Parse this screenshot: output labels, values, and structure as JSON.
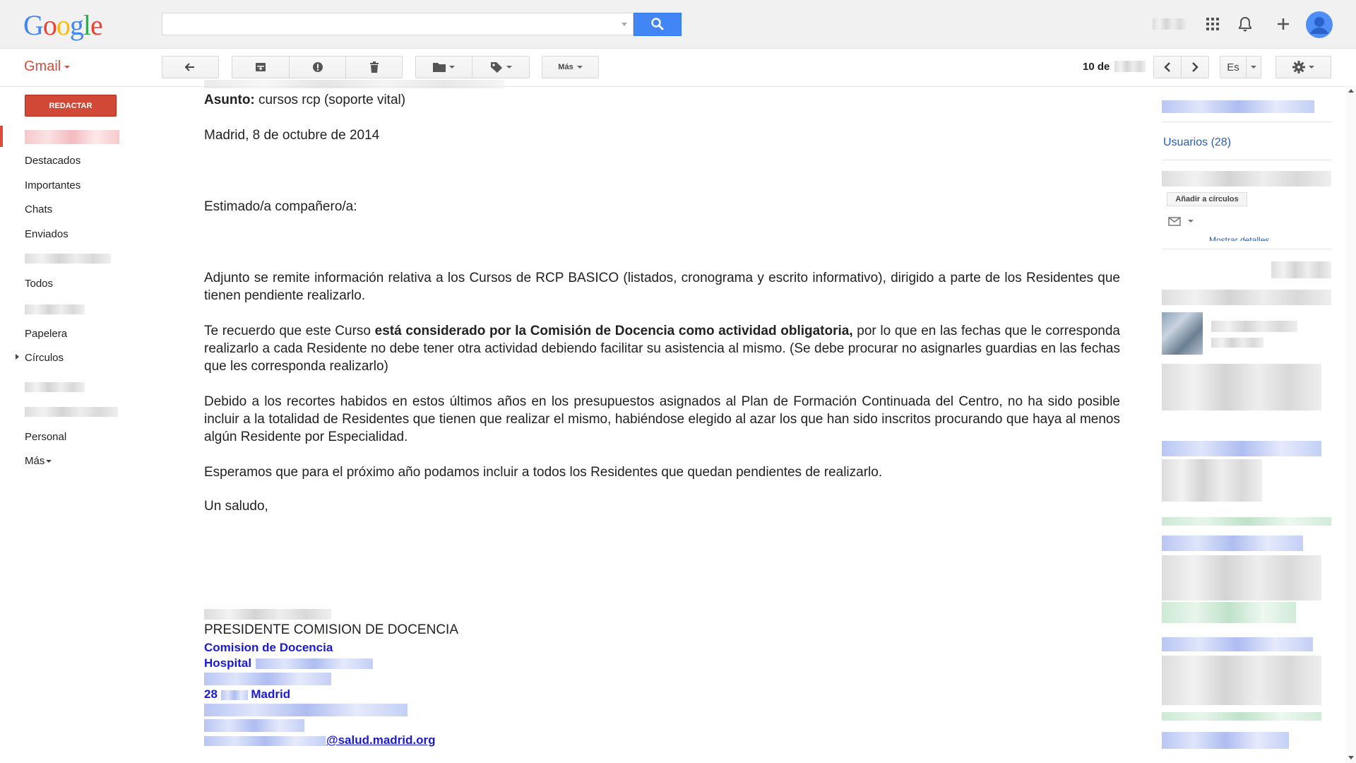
{
  "app": {
    "logo_text": "Google",
    "logo_letters": [
      "G",
      "o",
      "o",
      "g",
      "l",
      "e"
    ],
    "logo_colors": [
      "#4285f4",
      "#ea4335",
      "#fbbc05",
      "#4285f4",
      "#34a853",
      "#ea4335"
    ],
    "gmail_label": "Gmail",
    "accent_color": "#dd4b39",
    "search_button_color": "#4285f4"
  },
  "search": {
    "placeholder": "",
    "value": ""
  },
  "header_icons": [
    "apps-grid-icon",
    "bell-icon",
    "plus-icon",
    "avatar"
  ],
  "toolbar": {
    "back_icon": "back-arrow-icon",
    "archive_icon": "archive-icon",
    "spam_icon": "report-spam-icon",
    "delete_icon": "trash-icon",
    "move_icon": "folder-icon",
    "labels_icon": "label-icon",
    "more_label": "Más",
    "pagination_prefix": "10 de",
    "lang_label": "Es",
    "settings_icon": "gear-icon"
  },
  "sidebar": {
    "compose_label": "REDACTAR",
    "items": [
      {
        "label": "Destacados"
      },
      {
        "label": "Importantes"
      },
      {
        "label": "Chats"
      },
      {
        "label": "Enviados"
      },
      {
        "label": "Todos"
      },
      {
        "label": "Papelera"
      },
      {
        "label": "Círculos"
      },
      {
        "label": "Personal"
      },
      {
        "label": "Más"
      }
    ]
  },
  "email": {
    "subject_label": "Asunto:",
    "subject_value": "cursos rcp (soporte vital)",
    "date_line": "Madrid, 8 de octubre de 2014",
    "greeting": "Estimado/a compañero/a:",
    "p1": "Adjunto se remite información relativa a los Cursos de RCP BASICO (listados, cronograma y escrito informativo), dirigido a parte de los Residentes que tienen pendiente realizarlo.",
    "p2_pre": "Te recuerdo que este Curso ",
    "p2_bold": "está considerado por la Comisión de Docencia como actividad obligatoria,",
    "p2_post": " por lo que en las fechas que le corresponda realizarlo a cada Residente no debe tener otra actividad debiendo facilitar su asistencia al mismo. (Se debe procurar no asignarles guardias en las fechas que les corresponda realizarlo)",
    "p3": "Debido a los recortes habidos en estos últimos años en los presupuestos asignados al Plan de Formación Continuada del Centro, no ha sido posible incluir a la totalidad de Residentes que tienen que realizar el mismo, habiéndose elegido al azar los que han sido inscritos procurando que haya al menos algún Residente por Especialidad.",
    "p4": "Esperamos que para el próximo año podamos incluir a todos los Residentes que quedan pendientes de realizarlo.",
    "closing": "Un saludo,",
    "signature": {
      "role": "PRESIDENTE COMISION DE DOCENCIA",
      "org": "Comision de Docencia",
      "hospital": "Hospital",
      "postal_prefix": "28",
      "city": "Madrid",
      "email_domain": "@salud.madrid.org"
    }
  },
  "right_panel": {
    "users_label": "Usuarios (28)",
    "add_circles_label": "Añadir a círculos",
    "show_details_label": "Mostrar detalles"
  }
}
